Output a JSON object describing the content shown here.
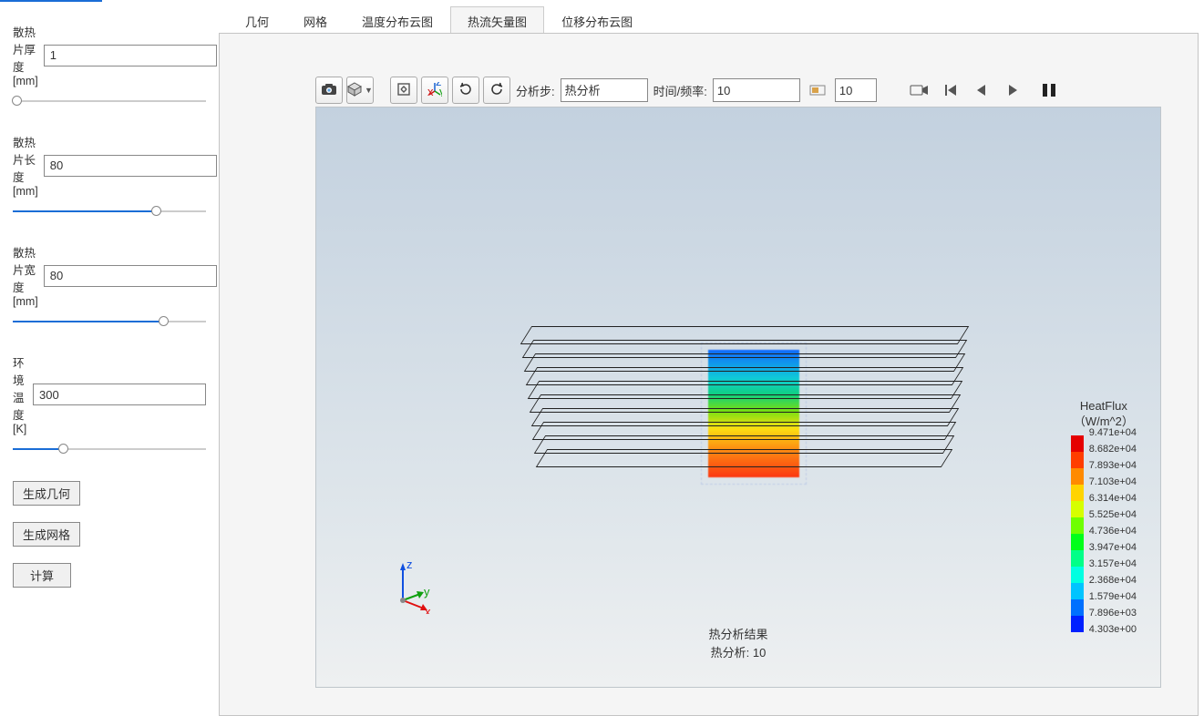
{
  "sidebar": {
    "params": [
      {
        "label": "散热片厚度[mm]",
        "value": "1",
        "fill": 2
      },
      {
        "label": "散热片长度[mm]",
        "value": "80",
        "fill": 74
      },
      {
        "label": "散热片宽度[mm]",
        "value": "80",
        "fill": 78
      },
      {
        "label": "环境温度[K]",
        "value": "300",
        "fill": 26
      }
    ],
    "buttons": {
      "geom": "生成几何",
      "mesh": "生成网格",
      "calc": "计算"
    }
  },
  "tabs": [
    "几何",
    "网格",
    "温度分布云图",
    "热流矢量图",
    "位移分布云图"
  ],
  "active_tab": 3,
  "toolbar": {
    "step_label": "分析步:",
    "step_value": "热分析",
    "time_label": "时间/频率:",
    "time_value": "10",
    "spin_value": "10"
  },
  "legend": {
    "title1": "HeatFlux",
    "title2": "（W/m^2）",
    "items": [
      {
        "c": "#e50000",
        "v": "9.471e+04"
      },
      {
        "c": "#ff3d00",
        "v": "8.682e+04"
      },
      {
        "c": "#ff8a00",
        "v": "7.893e+04"
      },
      {
        "c": "#ffd400",
        "v": "7.103e+04"
      },
      {
        "c": "#d6ff00",
        "v": "6.314e+04"
      },
      {
        "c": "#6fff00",
        "v": "5.525e+04"
      },
      {
        "c": "#00ff1a",
        "v": "4.736e+04"
      },
      {
        "c": "#00ff88",
        "v": "3.947e+04"
      },
      {
        "c": "#00ffe1",
        "v": "3.157e+04"
      },
      {
        "c": "#00c4ff",
        "v": "2.368e+04"
      },
      {
        "c": "#0070ff",
        "v": "1.579e+04"
      },
      {
        "c": "#0020ff",
        "v": "7.896e+03"
      },
      {
        "c": "#0000d0",
        "v": "4.303e+00"
      }
    ]
  },
  "bottom": {
    "line1": "热分析结果",
    "line2": "热分析: 10"
  },
  "icons": {
    "camera": "camera",
    "cube": "cube",
    "fit": "fit",
    "axes": "axes",
    "reset": "reset",
    "rotate": "rotate",
    "frame": "frame",
    "record": "record",
    "first": "first",
    "prev": "prev",
    "play": "play",
    "last": "last"
  }
}
